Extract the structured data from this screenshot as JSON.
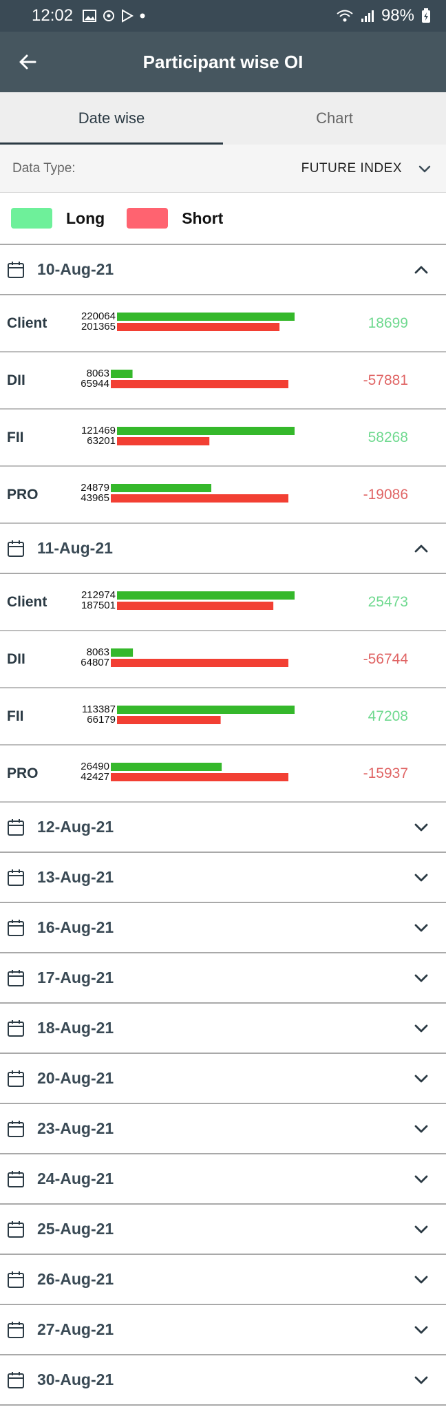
{
  "status_bar": {
    "time": "12:02",
    "battery": "98%"
  },
  "app_bar": {
    "title": "Participant wise OI"
  },
  "tabs": [
    {
      "label": "Date wise",
      "active": true
    },
    {
      "label": "Chart",
      "active": false
    }
  ],
  "data_type": {
    "label": "Data Type:",
    "value": "FUTURE INDEX"
  },
  "legend": {
    "long": {
      "label": "Long",
      "color": "#6ef09a"
    },
    "short": {
      "label": "Short",
      "color": "#ff6370"
    }
  },
  "bar_colors": {
    "long": "#35b82b",
    "short": "#f23f33"
  },
  "net_colors": {
    "positive": "#6fd98f",
    "negative": "#e06565"
  },
  "chart_data": {
    "type": "bar",
    "groups": [
      {
        "date": "10-Aug-21",
        "expanded": true,
        "participants": [
          {
            "name": "Client",
            "long": 220064,
            "short": 201365,
            "net": 18699
          },
          {
            "name": "DII",
            "long": 8063,
            "short": 65944,
            "net": -57881
          },
          {
            "name": "FII",
            "long": 121469,
            "short": 63201,
            "net": 58268
          },
          {
            "name": "PRO",
            "long": 24879,
            "short": 43965,
            "net": -19086
          }
        ]
      },
      {
        "date": "11-Aug-21",
        "expanded": true,
        "participants": [
          {
            "name": "Client",
            "long": 212974,
            "short": 187501,
            "net": 25473
          },
          {
            "name": "DII",
            "long": 8063,
            "short": 64807,
            "net": -56744
          },
          {
            "name": "FII",
            "long": 113387,
            "short": 66179,
            "net": 47208
          },
          {
            "name": "PRO",
            "long": 26490,
            "short": 42427,
            "net": -15937
          }
        ]
      }
    ]
  },
  "collapsed_dates": [
    "12-Aug-21",
    "13-Aug-21",
    "16-Aug-21",
    "17-Aug-21",
    "18-Aug-21",
    "20-Aug-21",
    "23-Aug-21",
    "24-Aug-21",
    "25-Aug-21",
    "26-Aug-21",
    "27-Aug-21",
    "30-Aug-21"
  ],
  "icons": {
    "back": "arrow-left-icon",
    "calendar": "calendar-icon",
    "expand": "chevron-down-icon",
    "collapse": "chevron-up-icon"
  }
}
